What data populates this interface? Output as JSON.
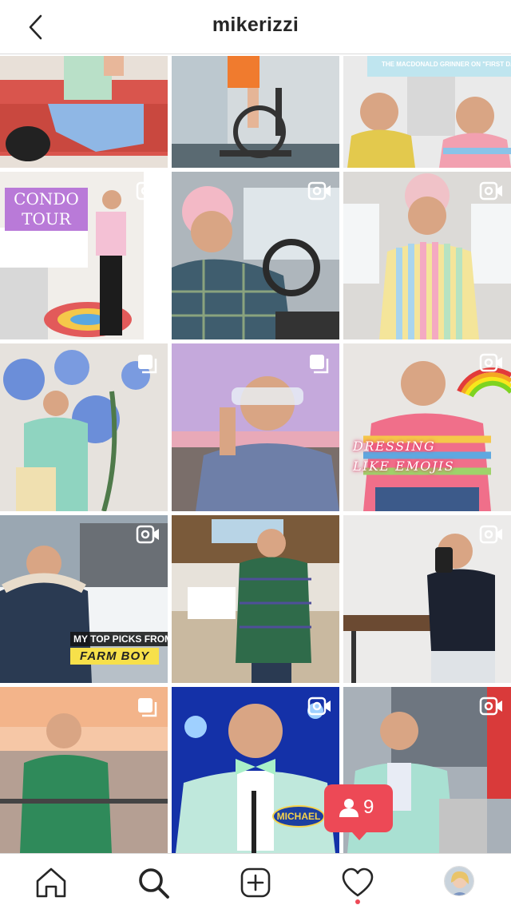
{
  "header": {
    "username": "mikerizzi",
    "back_icon": "chevron-left-icon"
  },
  "posts": [
    {
      "id": "post-1",
      "type": "image",
      "colors": [
        "#d9554d",
        "#8fb7e5"
      ]
    },
    {
      "id": "post-2",
      "type": "image",
      "colors": [
        "#c9d3d8",
        "#3a3a3a"
      ]
    },
    {
      "id": "post-3",
      "type": "image",
      "banner": "THE MACDONALD GRINNER ON \"FIRST DAY\"",
      "colors": [
        "#e3c94d",
        "#f2a0b0"
      ]
    },
    {
      "id": "post-4",
      "type": "video",
      "caption": "CONDO\nTOUR",
      "colors": [
        "#b97ad8",
        "#e6e2dc"
      ]
    },
    {
      "id": "post-5",
      "type": "video",
      "colors": [
        "#3f5d6e",
        "#9aa5ad"
      ]
    },
    {
      "id": "post-6",
      "type": "video",
      "colors": [
        "#d6d1cc",
        "#f0c2c8"
      ]
    },
    {
      "id": "post-7",
      "type": "carousel",
      "colors": [
        "#6b8ed9",
        "#8fd4c0"
      ]
    },
    {
      "id": "post-8",
      "type": "carousel",
      "colors": [
        "#c8a6d6",
        "#6e7fa8"
      ]
    },
    {
      "id": "post-9",
      "type": "video",
      "caption": "DRESSING\nLIKE EMOJIS",
      "colors": [
        "#f06f8a",
        "#5fa8e0"
      ]
    },
    {
      "id": "post-10",
      "type": "video",
      "caption_top": "MY TOP PICKS FROM",
      "caption_bottom": "FARM BOY",
      "colors": [
        "#9aa7b2",
        "#2a3a52"
      ]
    },
    {
      "id": "post-11",
      "type": "image",
      "colors": [
        "#7a5a3a",
        "#2f6b4a"
      ]
    },
    {
      "id": "post-12",
      "type": "video",
      "colors": [
        "#eaeaea",
        "#1c2230"
      ]
    },
    {
      "id": "post-13",
      "type": "carousel",
      "colors": [
        "#f3a07a",
        "#2f8a5a"
      ]
    },
    {
      "id": "post-14",
      "type": "video",
      "name_tag": "MICHAEL",
      "colors": [
        "#1431a8",
        "#bfe8dc"
      ]
    },
    {
      "id": "post-15",
      "type": "video",
      "colors": [
        "#a8b0b8",
        "#a9e0d2"
      ]
    }
  ],
  "notification": {
    "icon": "user-icon",
    "count": "9",
    "color": "#ed4956"
  },
  "nav": {
    "items": [
      "home-icon",
      "search-icon",
      "add-post-icon",
      "activity-heart-icon",
      "profile-avatar"
    ],
    "active": "search-icon"
  }
}
